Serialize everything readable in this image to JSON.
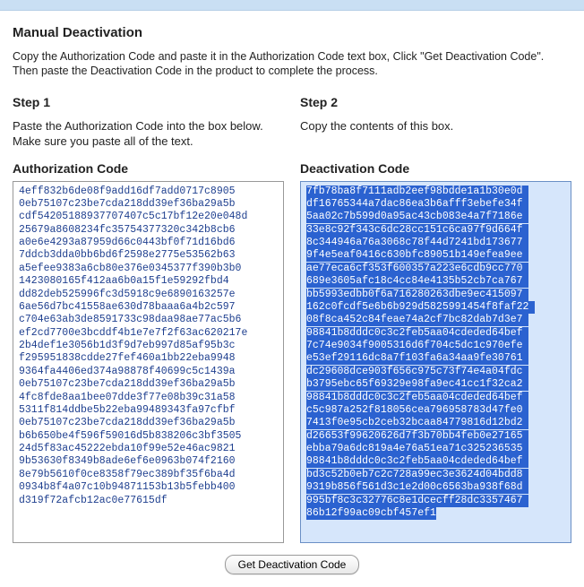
{
  "header": {
    "title": "Manual Deactivation",
    "intro": "Copy the Authorization Code and paste it in the Authorization Code text box, Click \"Get Deactivation Code\". Then paste the Deactivation Code in the product to complete the process."
  },
  "step1": {
    "title": "Step 1",
    "desc": "Paste the Authorization Code into the box below. Make sure you paste all of the text.",
    "code_label": "Authorization Code",
    "code": "4eff832b6de08f9add16df7add0717c8905\n0eb75107c23be7cda218dd39ef36ba29a5b\ncdf54205188937707407c5c17bf12e20e048d\n25679a8608234fc35754377320c342b8cb6\na0e6e4293a87959d66c0443bf0f71d16bd6\n7ddcb3dda0bb6bd6f2598e2775e53562b63\na5efee9383a6cb80e376e0345377f390b3b0\n1423080165f412aa6b0a15f1e59292fbd4\ndd82deb525996fc3d5918c9e6890163257e\n6ae56d7bc41558ae630d78baaa6a4b2c597\nc704e63ab3de8591733c98daa98ae77ac5b6\nef2cd7700e3bcddf4b1e7e7f2f63ac620217e\n2b4def1e3056b1d3f9d7eb997d85af95b3c\nf295951838cdde27fef460a1bb22eba9948\n9364fa4406ed374a98878f40699c5c1439a\n0eb75107c23be7cda218dd39ef36ba29a5b\n4fc8fde8aa1bee07dde3f77e08b39c31a58\n5311f814ddbe5b22eba99489343fa97cfbf\n0eb75107c23be7cda218dd39ef36ba29a5b\nb6b650be4f596f59016d5b838206c3bf3505\n24d5f83ac45222ebda10f99e52e46ac9821\n9b53630f8349b8ade6ef6e0963b074f2160\n8e79b5610f0ce8358f79ec389bf35f6ba4d\n0934b8f4a07c10b94871153b13b5febb400\nd319f72afcb12ac0e77615df"
  },
  "step2": {
    "title": "Step 2",
    "desc": "Copy the contents of this box.",
    "code_label": "Deactivation Code",
    "code": "7fb78ba8f7111adb2eef98bdde1a1b30e0d\ndf16765344a7dac86ea3b6afff3ebefe34f\n5aa02c7b599d0a95ac43cb083e4a7f7186e\n33e8c92f343c6dc28cc151c6ca97f9d664f\n8c344946a76a3068c78f44d7241bd173677\n9f4e5eaf0416c630bfc89051b149efea9ee\nae77eca6cf353f600357a223e6cdb9cc770\n689e3605afc18c4cc84e4135b52cb7ca767\nbb5993edbb0f6a716280263dbe9ec415097\n162c0fcdf5e6b6b929d5825991454f8faf22\n08f8ca452c84feae74a2cf7bc82dab7d3e7\n98841b8dddc0c3c2feb5aa04cdeded64bef\n7c74e9034f9005316d6f704c5dc1c970efe\ne53ef29116dc8a7f103fa6a34aa9fe30761\ndc29608dce903f656c975c73f74e4a04fdc\nb3795ebc65f69329e98fa9ec41cc1f32ca2\n98841b8dddc0c3c2feb5aa04cdeded64bef\nc5c987a252f818056cea796958783d47fe0\n7413f0e95cb2ceb32bcaa84779816d12bd2\nd26653f99620626d7f3b70bb4feb0e27165\nebba79a6dc819a4e76a51ea71c325236535\n98841b8dddc0c3c2feb5aa04cdeded64bef\nbd3c52b0eb7c2c728a99ec3e3624d04bdd8\n9319b856f561d3c1e2d00c6563ba938f68d\n995bf8c3c32776c8e1dcecff28dc3357467\n86b12f99ac09cbf457ef1"
  },
  "actions": {
    "get_code_label": "Get Deactivation Code"
  }
}
